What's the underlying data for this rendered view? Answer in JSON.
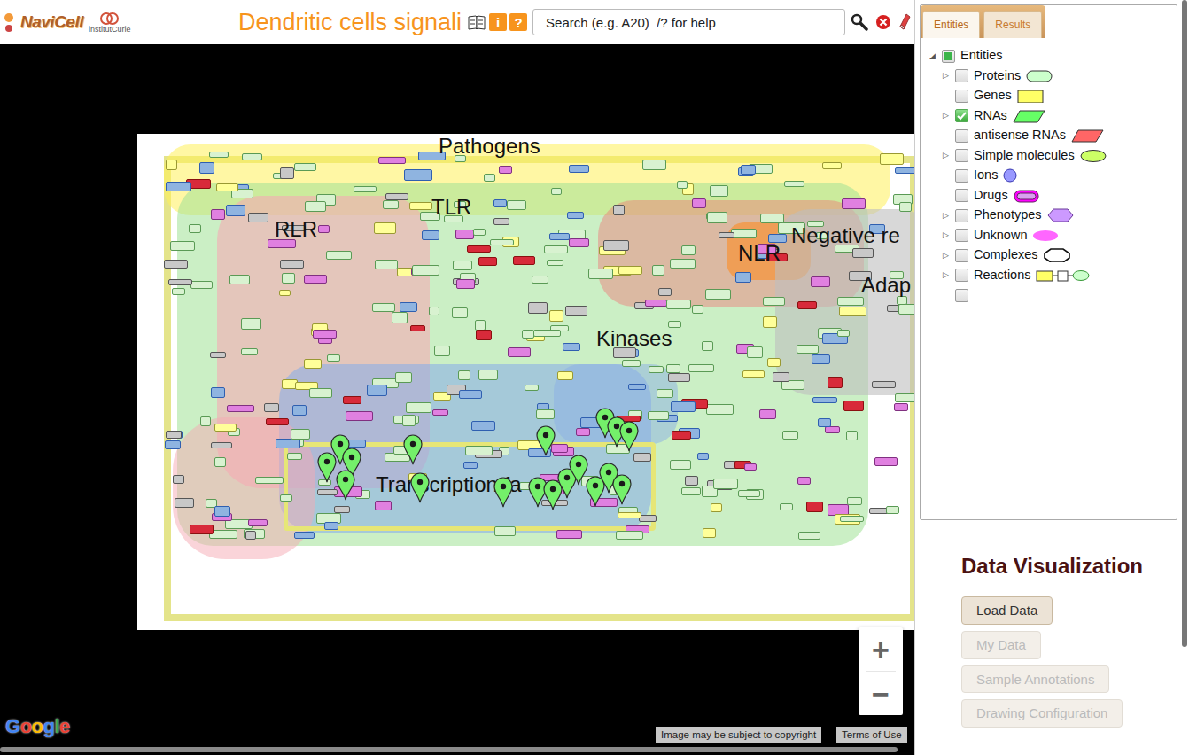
{
  "header": {
    "logo": "NaviCell",
    "partner": "institutCurie",
    "title": "Dendritic cells signali",
    "info_icon": "i",
    "help_icon": "?"
  },
  "search": {
    "placeholder": "Search (e.g. A20)  /? for help"
  },
  "map": {
    "regions": [
      {
        "label": "Pathogens"
      },
      {
        "label": "TLR"
      },
      {
        "label": "RLR"
      },
      {
        "label": "NLR"
      },
      {
        "label": "Negative re"
      },
      {
        "label": "Adap"
      },
      {
        "label": "Kinases"
      },
      {
        "label": "Transcription fa"
      }
    ],
    "zoom_in": "+",
    "zoom_out": "−",
    "attribution": "Image may be subject to copyright",
    "terms": "Terms of Use",
    "provider": "Google"
  },
  "panel_tabs": [
    {
      "label": "Entities",
      "selected": true
    },
    {
      "label": "Results",
      "selected": false
    }
  ],
  "tree": {
    "root": {
      "label": "Entities",
      "expanded": true,
      "checked": false,
      "partial": true
    },
    "items": [
      {
        "label": "Proteins",
        "expandable": true,
        "checked": false,
        "kind": "protein",
        "color": "#ccffcc"
      },
      {
        "label": "Genes",
        "expandable": false,
        "checked": false,
        "kind": "gene",
        "color": "#ffff66"
      },
      {
        "label": "RNAs",
        "expandable": true,
        "checked": true,
        "kind": "rna",
        "color": "#66ff66"
      },
      {
        "label": "antisense RNAs",
        "expandable": false,
        "checked": false,
        "kind": "antisense",
        "color": "#ff6666"
      },
      {
        "label": "Simple molecules",
        "expandable": true,
        "checked": false,
        "kind": "simple",
        "color": "#ccff66"
      },
      {
        "label": "Ions",
        "expandable": false,
        "checked": false,
        "kind": "ion",
        "color": "#9999ff"
      },
      {
        "label": "Drugs",
        "expandable": false,
        "checked": false,
        "kind": "drug",
        "color": "#ff00ff"
      },
      {
        "label": "Phenotypes",
        "expandable": true,
        "checked": false,
        "kind": "phenotype",
        "color": "#cc99ff"
      },
      {
        "label": "Unknown",
        "expandable": true,
        "checked": false,
        "kind": "unknown",
        "color": "#ff66ff"
      },
      {
        "label": "Complexes",
        "expandable": true,
        "checked": false,
        "kind": "complex",
        "color": "#ffffff"
      },
      {
        "label": "Reactions",
        "expandable": true,
        "checked": false,
        "kind": "reaction",
        "color": "#ffff66"
      },
      {
        "label": "",
        "expandable": false,
        "checked": false,
        "kind": "none",
        "color": "#ffffff"
      }
    ]
  },
  "data_visualization": {
    "title": "Data Visualization",
    "buttons": [
      {
        "label": "Load Data",
        "disabled": false
      },
      {
        "label": "My Data",
        "disabled": true
      },
      {
        "label": "Sample Annotations",
        "disabled": true
      },
      {
        "label": "Drawing Configuration",
        "disabled": true
      }
    ]
  }
}
